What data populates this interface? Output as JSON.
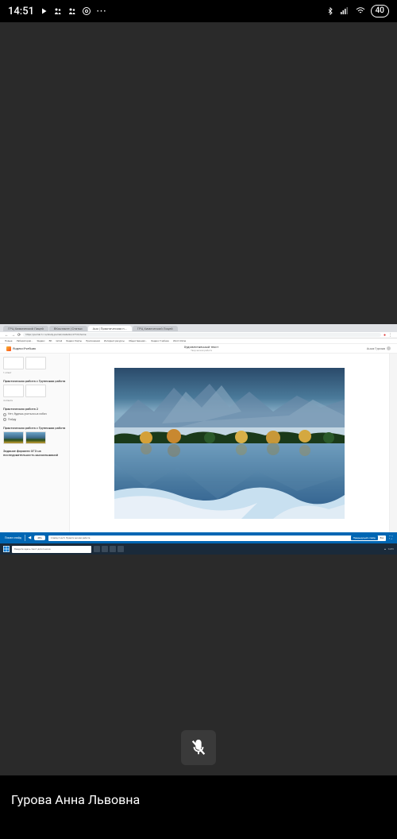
{
  "status": {
    "time": "14:51",
    "battery": "40",
    "icons": [
      "play-icon",
      "teams-icon",
      "teams-icon",
      "chrome-icon",
      "more-icon"
    ],
    "right_icons": [
      "bluetooth-icon",
      "signal-icon",
      "wifi-icon"
    ]
  },
  "call": {
    "participant_name": "Гурова Анна Львовна",
    "mic_muted": true
  },
  "desktop": {
    "tabs": [
      "ГРЦ Химический Лицей",
      "ВКонтакте | Статьи",
      "Аня | Практическая п...",
      "ГРЦ Химический Лицей"
    ],
    "address": "https://journal.1c.ru/study-journal/students/47723/home",
    "bookmarks": [
      "Новые",
      "Лаборатория...",
      "Яндекс",
      "ВК",
      "Gmail",
      "Яндекс Карты",
      "Приложения",
      "Интернет-ресурсы",
      "Общественная...",
      "Яндекс Учебник",
      "Word Online"
    ],
    "app": {
      "brand": "ЯндексУчебник",
      "title": "Художественный текст",
      "subtitle": "Творческая работа",
      "user": "Анна Гурова"
    },
    "sidebar": {
      "items": [
        {
          "title": "",
          "sub": "1 ответ",
          "thumbs": 2
        },
        {
          "title": "Практическая работа с Групповая работа",
          "sub": "4 ответа",
          "thumbs": 2
        },
        {
          "title": "Практическая работа 2",
          "options": [
            "Нет, будешь учиться на собач",
            "Пойду"
          ]
        },
        {
          "title": "Практическая работа с Групповая работа",
          "thumbs_img": 2
        },
        {
          "title": "Задание формата ОГЭ на последовательность высказываний"
        }
      ]
    },
    "footer": {
      "left_label": "Показ слайд",
      "page": "46%",
      "input_placeholder": "Слайд 3 из 8. Практическая работа",
      "button": "Предыдущий слайд",
      "close": "Esc"
    },
    "taskbar": {
      "search_placeholder": "Введите здесь текст для поиска",
      "time": "14:51",
      "date": ""
    }
  }
}
